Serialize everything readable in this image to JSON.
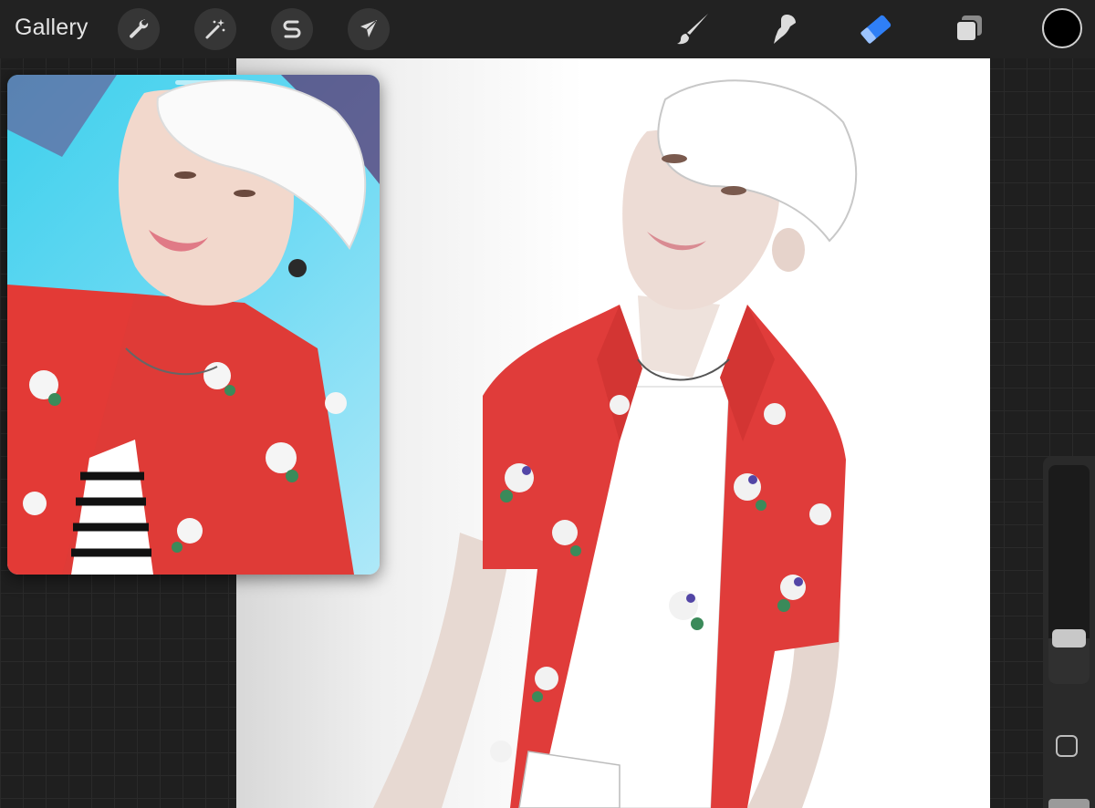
{
  "toolbar": {
    "gallery_label": "Gallery",
    "left_tools": [
      {
        "icon": "wrench-icon",
        "name": "actions"
      },
      {
        "icon": "magic-wand-icon",
        "name": "adjustments"
      },
      {
        "icon": "selection-s-icon",
        "name": "selection"
      },
      {
        "icon": "arrow-cursor-icon",
        "name": "transform"
      }
    ],
    "right_tools": [
      {
        "icon": "brush-icon",
        "name": "paint"
      },
      {
        "icon": "smudge-icon",
        "name": "smudge"
      },
      {
        "icon": "eraser-icon",
        "name": "erase",
        "active": true
      },
      {
        "icon": "layers-icon",
        "name": "layers"
      }
    ],
    "current_color": "#000000",
    "active_tool_color": "#2f7ff6"
  },
  "sidebar": {
    "brush_size_level": 0.82,
    "opacity_level": 0.15
  }
}
